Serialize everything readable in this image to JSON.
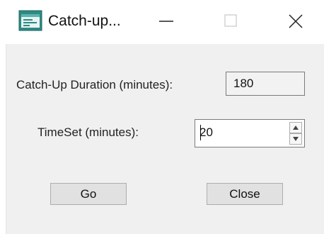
{
  "window": {
    "title": "Catch-up...",
    "icons": {
      "app": "app-window-icon",
      "minimize": "minimize-icon",
      "maximize": "maximize-icon",
      "close": "close-icon"
    }
  },
  "form": {
    "duration_label": "Catch-Up Duration (minutes):",
    "duration_value": "180",
    "timeset_label": "TimeSet  (minutes):",
    "timeset_value": "20"
  },
  "buttons": {
    "go": "Go",
    "close": "Close"
  },
  "colors": {
    "client_bg": "#f0f0f0",
    "button_bg": "#e1e1e1",
    "border": "#7a7a7a",
    "app_icon": "#2d8a84"
  }
}
